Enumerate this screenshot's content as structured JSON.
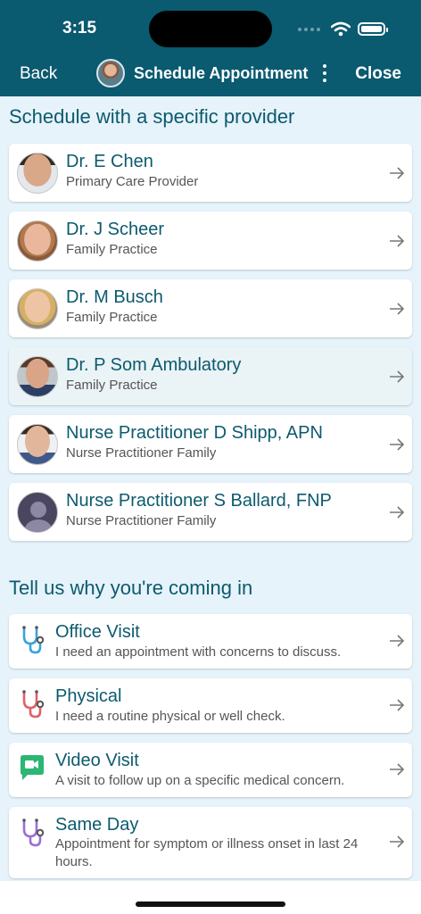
{
  "status_bar": {
    "time": "3:15"
  },
  "nav": {
    "back_label": "Back",
    "title": "Schedule Appointment",
    "close_label": "Close"
  },
  "providers_section": {
    "title": "Schedule with a specific provider",
    "items": [
      {
        "name": "Dr. E Chen",
        "specialty": "Primary Care Provider"
      },
      {
        "name": "Dr. J Scheer",
        "specialty": "Family Practice"
      },
      {
        "name": "Dr. M Busch",
        "specialty": "Family Practice"
      },
      {
        "name": "Dr. P Som Ambulatory",
        "specialty": "Family Practice"
      },
      {
        "name": "Nurse Practitioner D Shipp, APN",
        "specialty": "Nurse Practitioner Family"
      },
      {
        "name": "Nurse Practitioner S Ballard, FNP",
        "specialty": "Nurse Practitioner Family"
      }
    ]
  },
  "reasons_section": {
    "title": "Tell us why you're coming in",
    "items": [
      {
        "title": "Office Visit",
        "description": "I need an appointment with concerns to discuss.",
        "icon": "stethoscope-icon",
        "color": "#3aa3d9"
      },
      {
        "title": "Physical",
        "description": "I need a routine physical or well check.",
        "icon": "stethoscope-icon",
        "color": "#e0606a"
      },
      {
        "title": "Video Visit",
        "description": "A visit to follow up on a specific medical concern.",
        "icon": "video-camera-icon",
        "color": "#2bb673"
      },
      {
        "title": "Same Day",
        "description": "Appointment for symptom or illness onset in last 24 hours.",
        "icon": "stethoscope-icon",
        "color": "#9b6fd6"
      }
    ]
  },
  "colors": {
    "header": "#0a5a70",
    "background": "#e6f3fa",
    "accent_text": "#0c5a6e",
    "highlight_row": "#eaf3f5"
  }
}
